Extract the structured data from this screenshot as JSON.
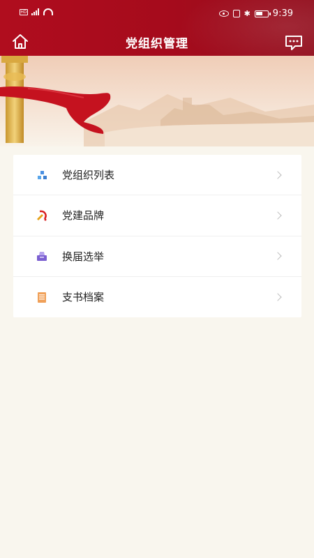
{
  "status_bar": {
    "time": "9:39",
    "sim_label": "HD"
  },
  "header": {
    "title": "党组织管理"
  },
  "icons": {
    "home": "home-icon",
    "message": "message-icon"
  },
  "menu": {
    "items": [
      {
        "label": "党组织列表",
        "icon": "org-chart-icon"
      },
      {
        "label": "党建品牌",
        "icon": "party-emblem-icon"
      },
      {
        "label": "换届选举",
        "icon": "ballot-box-icon"
      },
      {
        "label": "支书档案",
        "icon": "archive-icon"
      }
    ]
  },
  "colors": {
    "header_red": "#b00d1e",
    "background": "#f9f6ee",
    "card": "#ffffff"
  }
}
